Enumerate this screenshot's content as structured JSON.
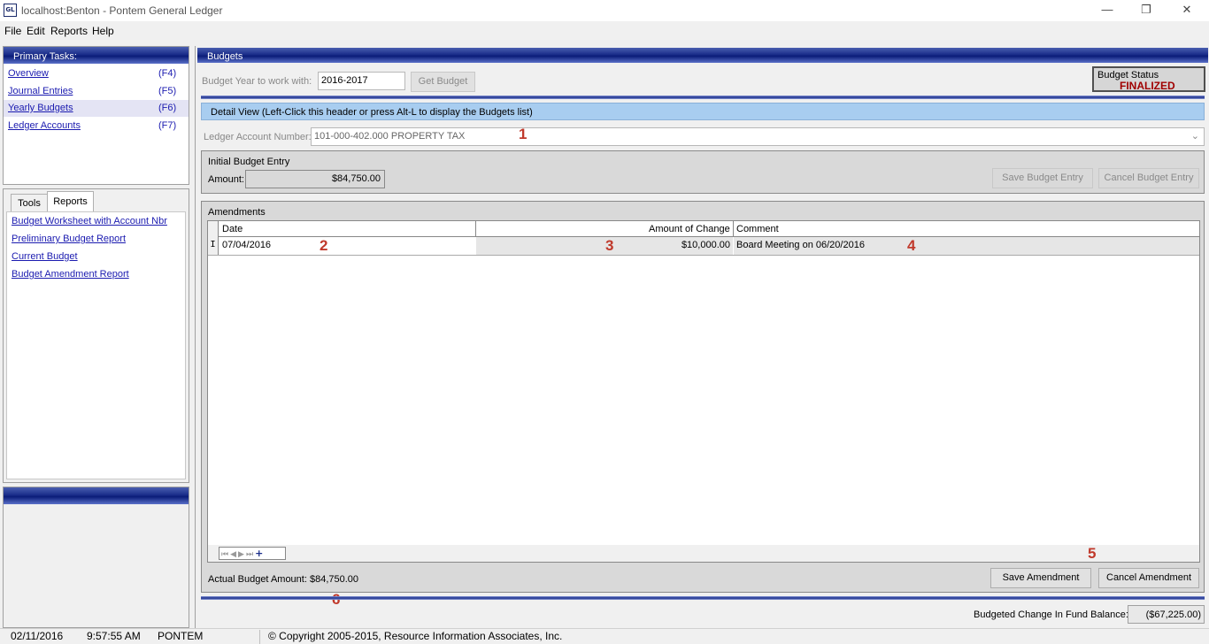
{
  "window": {
    "title": "localhost:Benton - Pontem General Ledger",
    "icon_text": "GL",
    "controls": {
      "minimize": "—",
      "restore": "❐",
      "close": "✕"
    }
  },
  "menu": [
    {
      "label": "File"
    },
    {
      "label": "Edit"
    },
    {
      "label": "Reports"
    },
    {
      "label": "Help"
    }
  ],
  "primary_tasks": {
    "header": "Primary Tasks:",
    "items": [
      {
        "label": "Overview",
        "key": "(F4)"
      },
      {
        "label": "Journal Entries",
        "key": "(F5)"
      },
      {
        "label": "Yearly Budgets",
        "key": "(F6)"
      },
      {
        "label": "Ledger Accounts",
        "key": "(F7)"
      }
    ]
  },
  "side_tabs": {
    "tabs": [
      {
        "label": "Tools"
      },
      {
        "label": "Reports"
      }
    ],
    "active": "Reports",
    "reports": [
      {
        "label": "Budget Worksheet with Account Nbr"
      },
      {
        "label": "Preliminary Budget Report"
      },
      {
        "label": "Current Budget"
      },
      {
        "label": "Budget Amendment Report"
      }
    ]
  },
  "budgets": {
    "header": "Budgets",
    "year_label": "Budget Year to work with:",
    "year_value": "2016-2017",
    "get_budget_button": "Get Budget",
    "status_label": "Budget Status",
    "status_value": "FINALIZED",
    "detail_header": "Detail View (Left-Click this header or press Alt-L to display the Budgets list)",
    "ledger_label": "Ledger Account Number:",
    "ledger_value": "101-000-402.000   PROPERTY TAX",
    "initial": {
      "title": "Initial Budget Entry",
      "amount_label": "Amount:",
      "amount_value": "$84,750.00",
      "save_button": "Save Budget Entry",
      "cancel_button": "Cancel Budget Entry"
    },
    "amendments": {
      "title": "Amendments",
      "columns": {
        "date": "Date",
        "amount": "Amount of Change",
        "comment": "Comment"
      },
      "rows": [
        {
          "indicator": "I",
          "date": "07/04/2016",
          "amount": "$10,000.00",
          "comment": "Board Meeting on 06/20/2016"
        }
      ],
      "actual_label": "Actual Budget Amount: $84,750.00",
      "save_button": "Save Amendment",
      "cancel_button": "Cancel Amendment"
    },
    "fund_balance_label": "Budgeted Change In Fund Balance:",
    "fund_balance_value": "($67,225.00)"
  },
  "annotations": [
    "1",
    "2",
    "3",
    "4",
    "5",
    "6"
  ],
  "status_bar": {
    "date": "02/11/2016",
    "time": "9:57:55 AM",
    "user": "PONTEM",
    "copyright": "© Copyright 2005-2015, Resource Information Associates, Inc."
  },
  "colors": {
    "accent_blue": "#0a1c78",
    "link": "#1b1bb0",
    "status_red": "#a00000",
    "annotation_red": "#c0392b",
    "detail_header_bg": "#a8cdf0"
  }
}
